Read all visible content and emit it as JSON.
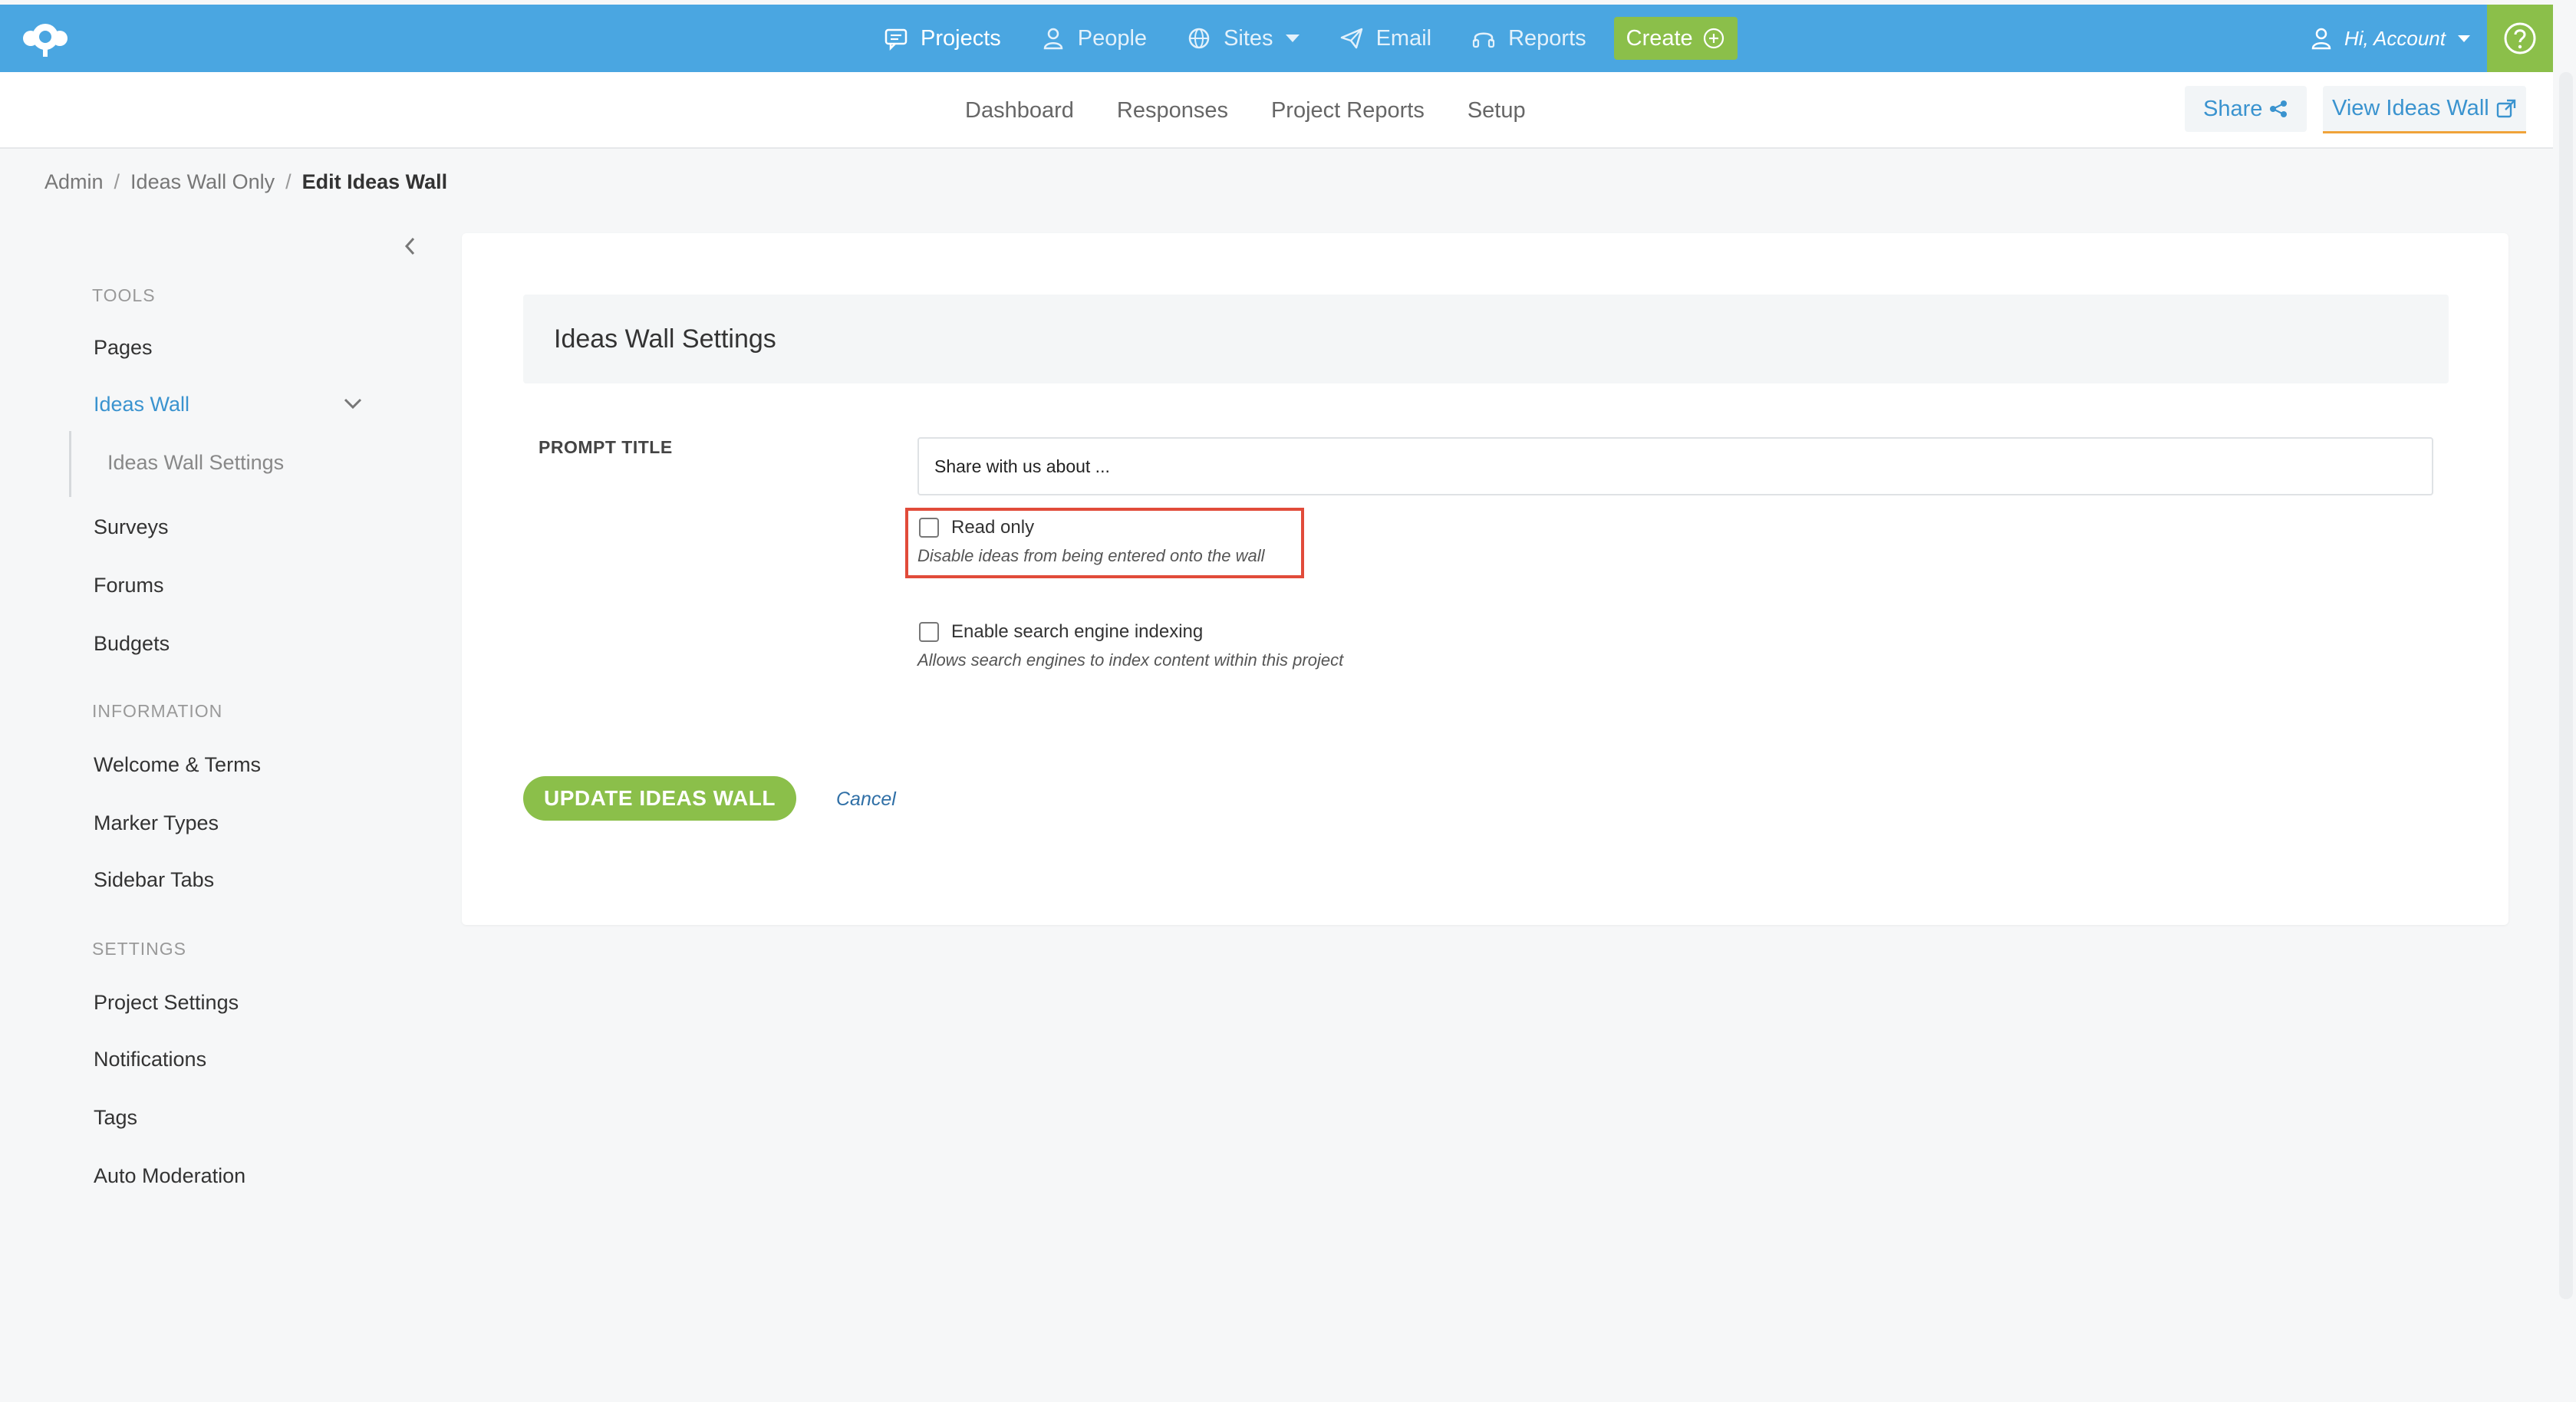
{
  "topnav": {
    "items": [
      {
        "label": "Projects",
        "icon": "chat-icon"
      },
      {
        "label": "People",
        "icon": "person-icon"
      },
      {
        "label": "Sites",
        "icon": "globe-icon"
      },
      {
        "label": "Email",
        "icon": "paper-plane-icon"
      },
      {
        "label": "Reports",
        "icon": "headset-icon"
      }
    ],
    "create_label": "Create",
    "account_label": "Hi, Account"
  },
  "subnav": {
    "links": [
      "Dashboard",
      "Responses",
      "Project Reports",
      "Setup"
    ],
    "share_label": "Share",
    "view_label": "View Ideas Wall"
  },
  "breadcrumb": {
    "items": [
      "Admin",
      "Ideas Wall Only"
    ],
    "current": "Edit Ideas Wall"
  },
  "sidebar": {
    "tools_heading": "TOOLS",
    "tools": [
      "Pages",
      "Ideas Wall",
      "Surveys",
      "Forums",
      "Budgets"
    ],
    "ideas_sub": "Ideas Wall Settings",
    "info_heading": "INFORMATION",
    "info": [
      "Welcome & Terms",
      "Marker Types",
      "Sidebar Tabs"
    ],
    "settings_heading": "SETTINGS",
    "settings": [
      "Project Settings",
      "Notifications",
      "Tags",
      "Auto Moderation"
    ]
  },
  "form": {
    "title": "Ideas Wall Settings",
    "prompt_label": "PROMPT TITLE",
    "prompt_value": "Share with us about ...",
    "read_only_label": "Read only",
    "read_only_desc": "Disable ideas from being entered onto the wall",
    "indexing_label": "Enable search engine indexing",
    "indexing_desc": "Allows search engines to index content within this project",
    "update_label": "UPDATE IDEAS WALL",
    "cancel_label": "Cancel"
  },
  "colors": {
    "topbar": "#4aa6e1",
    "accent_green": "#8bbf4a",
    "link_blue": "#3a93cf",
    "highlight_red": "#e14b3a"
  }
}
